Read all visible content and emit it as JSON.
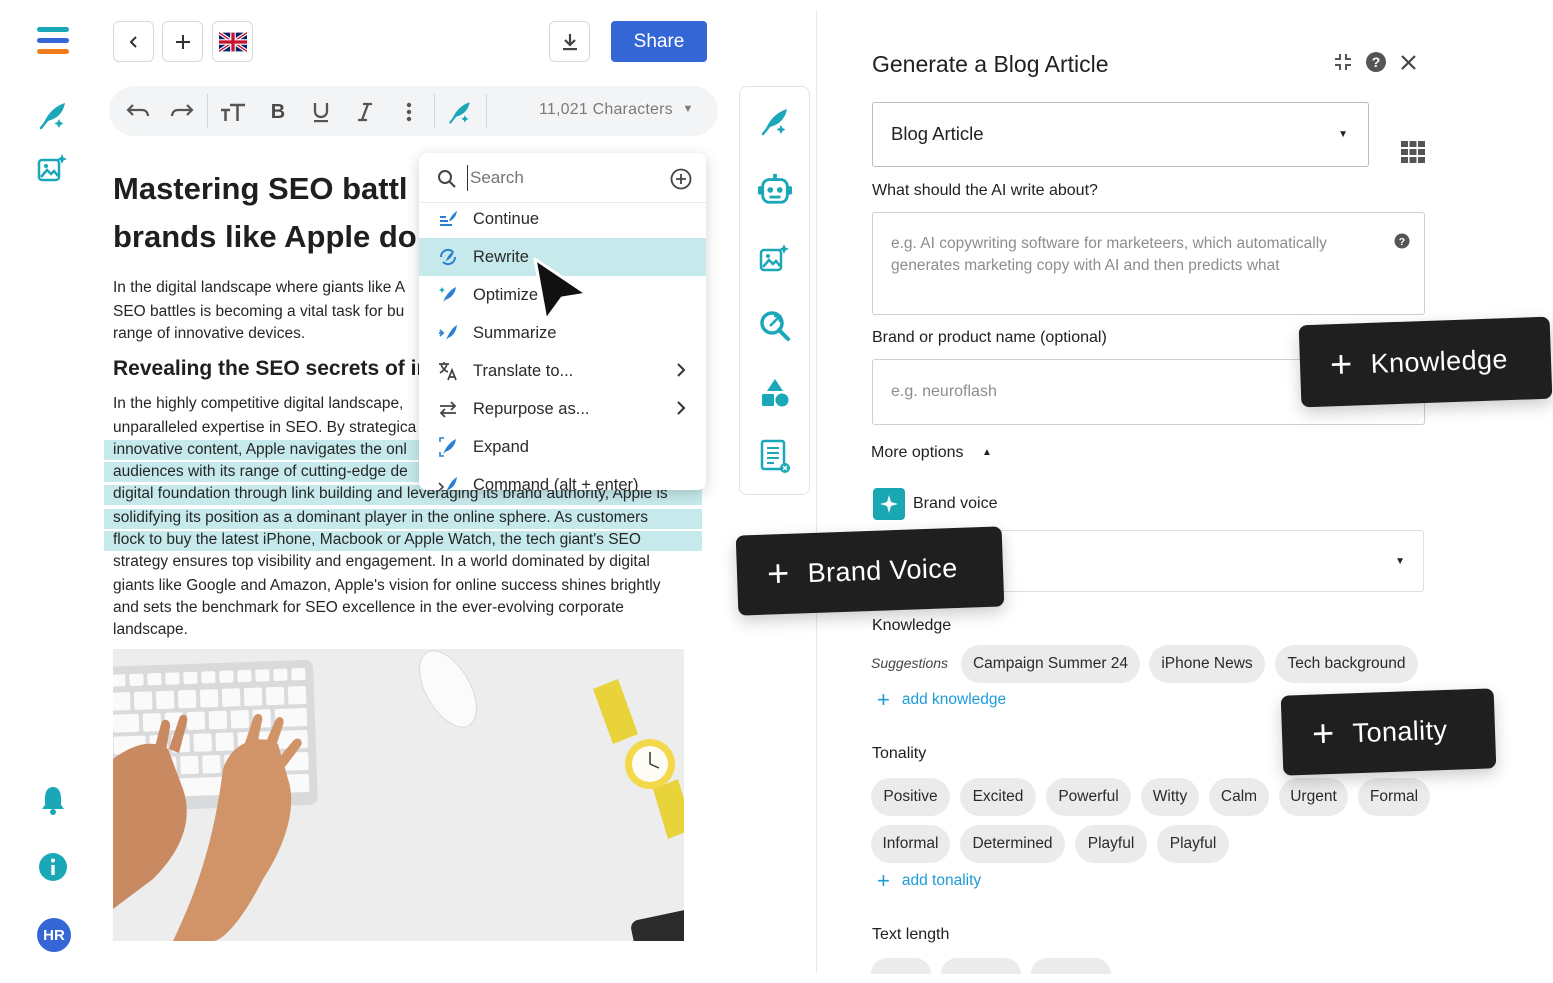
{
  "toolbar": {
    "characters": "11,021 Characters"
  },
  "top": {
    "share_label": "Share"
  },
  "document": {
    "title_line1": "Mastering SEO battl",
    "title_line2": "brands like Apple do",
    "intro": [
      "In the digital landscape where giants like A",
      "SEO battles is becoming a vital task for bu",
      "range of innovative devices."
    ],
    "heading2": "Revealing the SEO secrets of in",
    "body": [
      "In the highly competitive digital landscape,",
      "unparalleled expertise in SEO. By strategica",
      "innovative content, Apple navigates the onl",
      "audiences with its range of cutting-edge de",
      "digital foundation through link building and leveraging its brand authority, Apple is",
      "solidifying its position as a dominant player in the online sphere. As customers",
      "flock to buy the latest iPhone, Macbook or Apple Watch, the tech giant's SEO",
      "strategy ensures top visibility and engagement. In a world dominated by digital",
      "giants like Google and Amazon, Apple's vision for online success shines brightly",
      "and sets the benchmark for SEO excellence in the ever-evolving corporate",
      "landscape."
    ]
  },
  "menu": {
    "search_placeholder": "Search",
    "items": [
      {
        "label": "Continue"
      },
      {
        "label": "Rewrite"
      },
      {
        "label": "Optimize"
      },
      {
        "label": "Summarize"
      },
      {
        "label": "Translate to..."
      },
      {
        "label": "Repurpose as..."
      },
      {
        "label": "Expand"
      },
      {
        "label": "Command (alt + enter)"
      }
    ]
  },
  "panel": {
    "title": "Generate a Blog Article",
    "type_value": "Blog Article",
    "topic_label": "What should the AI write about?",
    "topic_placeholder": "e.g. AI copywriting software for marketeers, which automatically generates marketing copy with AI and then predicts what",
    "brand_label": "Brand or product name (optional)",
    "brand_placeholder": "e.g. neuroflash",
    "more_options": "More options",
    "brand_voice_label": "Brand voice",
    "knowledge_label": "Knowledge",
    "suggestions_label": "Suggestions",
    "knowledge_chips": [
      "Campaign Summer 24",
      "iPhone News",
      "Tech background"
    ],
    "add_knowledge": "add knowledge",
    "tonality_label": "Tonality",
    "tonality_chips_row1": [
      "Positive",
      "Excited",
      "Powerful",
      "Witty",
      "Calm",
      "Urgent",
      "Formal"
    ],
    "tonality_chips_row2": [
      "Informal",
      "Determined",
      "Playful",
      "Playful"
    ],
    "add_tonality": "add tonality",
    "text_length_label": "Text length"
  },
  "callouts": {
    "knowledge": "Knowledge",
    "brand_voice": "Brand Voice",
    "tonality": "Tonality"
  },
  "user": {
    "initials": "HR"
  },
  "colors": {
    "accent": "#1aa8b8",
    "primary": "#3566d6",
    "highlight": "#c6eaec"
  }
}
